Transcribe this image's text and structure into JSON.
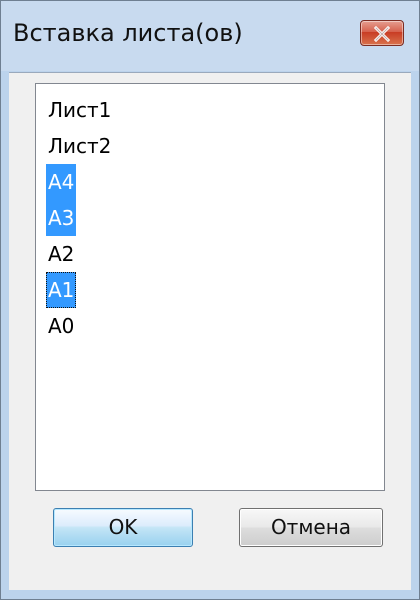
{
  "dialog": {
    "title": "Вставка листа(ов)",
    "close_icon": "close-icon"
  },
  "list": {
    "items": [
      {
        "label": "Лист1",
        "selected": false,
        "focused": false
      },
      {
        "label": "Лист2",
        "selected": false,
        "focused": false
      },
      {
        "label": "A4",
        "selected": true,
        "focused": false
      },
      {
        "label": "A3",
        "selected": true,
        "focused": false
      },
      {
        "label": "A2",
        "selected": false,
        "focused": false
      },
      {
        "label": "A1",
        "selected": true,
        "focused": true
      },
      {
        "label": "A0",
        "selected": false,
        "focused": false
      }
    ]
  },
  "buttons": {
    "ok_label": "OK",
    "cancel_label": "Отмена"
  },
  "colors": {
    "selection": "#3399ff",
    "window_frame": "#bcd3ec",
    "close_button": "#c83b24"
  }
}
